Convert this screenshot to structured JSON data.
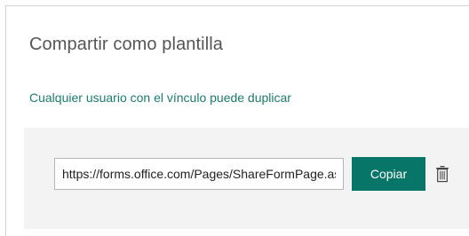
{
  "dialog": {
    "title": "Compartir como plantilla",
    "subtitle": "Cualquier usuario con el vínculo puede duplicar"
  },
  "share_link": {
    "value": "https://forms.office.com/Pages/ShareFormPage.aspx?id=",
    "copy_label": "Copiar",
    "delete_icon": "trash-icon"
  },
  "colors": {
    "accent": "#077568",
    "subtitle": "#1e7a6f",
    "panel_bg": "#f3f3f3"
  }
}
